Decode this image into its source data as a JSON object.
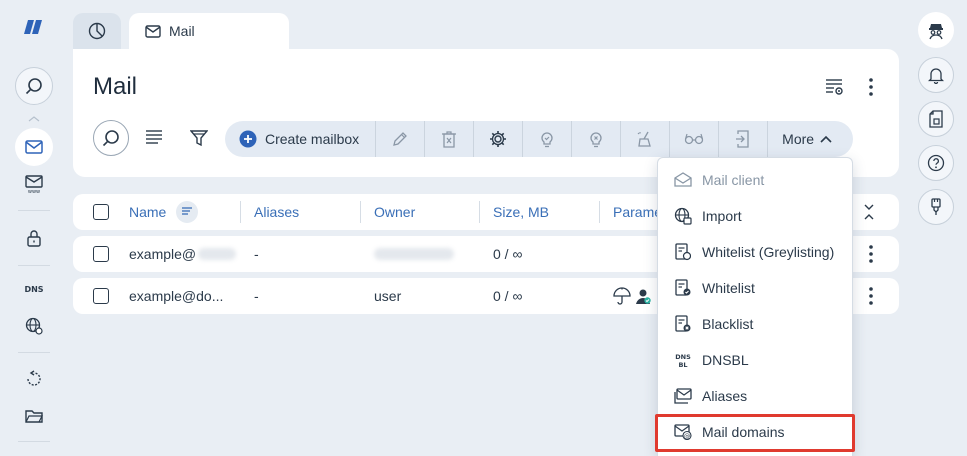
{
  "colors": {
    "accent": "#3a6fb7",
    "primary_blue": "#2e63b8",
    "highlight": "#e03a2f",
    "background": "#e9eef4"
  },
  "tabs": {
    "home_icon": "pie-chart-icon",
    "active_label": "Mail"
  },
  "page": {
    "title": "Mail"
  },
  "toolbar": {
    "create_label": "Create mailbox",
    "more_label": "More"
  },
  "table": {
    "columns": [
      "Name",
      "Aliases",
      "Owner",
      "Size, MB",
      "Parame"
    ],
    "rows": [
      {
        "name": "example@",
        "aliases": "-",
        "owner": "",
        "size": "0 / ∞"
      },
      {
        "name": "example@do...",
        "aliases": "-",
        "owner": "user",
        "size": "0 / ∞"
      }
    ]
  },
  "more_menu": {
    "items": [
      {
        "label": "Mail client",
        "icon": "mail-client-icon",
        "disabled": true
      },
      {
        "label": "Import",
        "icon": "globe-import-icon"
      },
      {
        "label": "Whitelist (Greylisting)",
        "icon": "greylist-icon"
      },
      {
        "label": "Whitelist",
        "icon": "whitelist-icon"
      },
      {
        "label": "Blacklist",
        "icon": "blacklist-icon"
      },
      {
        "label": "DNSBL",
        "icon": "dnsbl-icon"
      },
      {
        "label": "Aliases",
        "icon": "aliases-icon"
      },
      {
        "label": "Mail domains",
        "icon": "mail-domains-icon",
        "highlighted": true
      }
    ]
  }
}
